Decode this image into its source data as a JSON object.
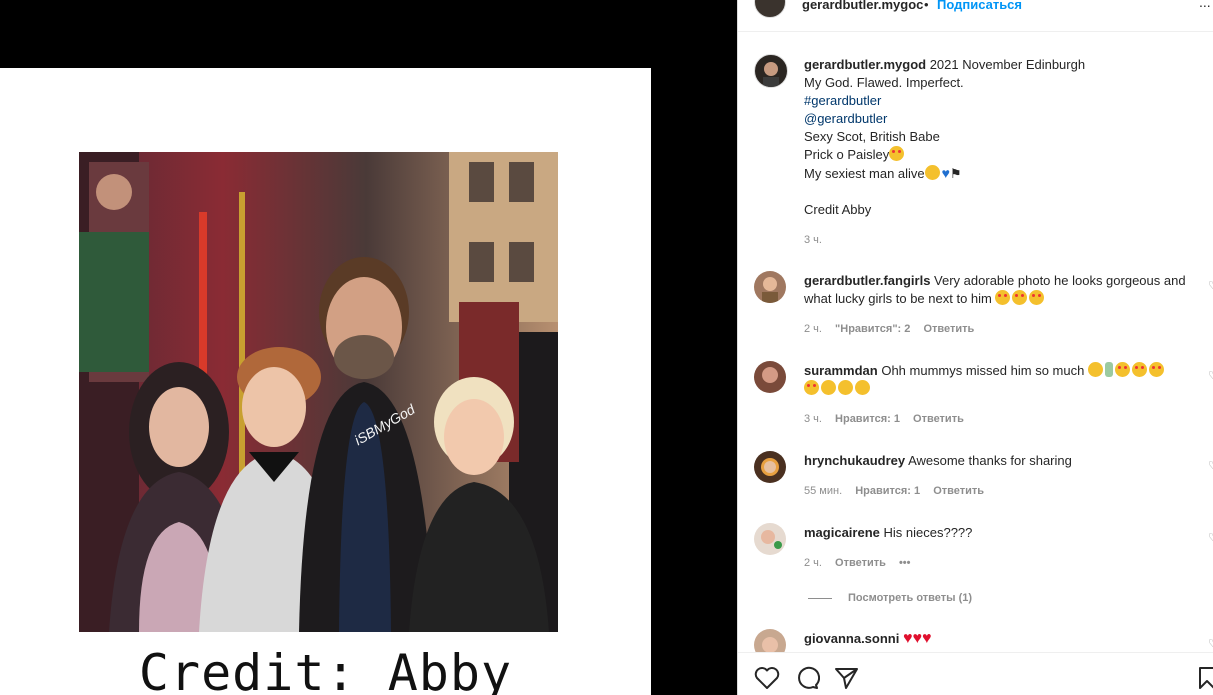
{
  "post": {
    "credit_text": "Credit: Abby",
    "watermark": "iSBMyGod"
  },
  "header": {
    "username": "gerardbutler.mygoc",
    "separator": "•",
    "follow_label": "Подписаться",
    "more_label": "..."
  },
  "caption": {
    "username": "gerardbutler.mygod",
    "lines": [
      "2021 November Edinburgh",
      "My God. Flawed. Imperfect.",
      "#gerardbutler",
      "@gerardbutler",
      "Sexy Scot, British Babe",
      "Prick o Paisley",
      "My sexiest man alive",
      "Credit Abby"
    ],
    "time": "3 ч."
  },
  "comments": [
    {
      "username": "gerardbutler.fangirls",
      "text": "Very adorable photo he looks gorgeous and what lucky girls to be next to him",
      "time": "2 ч.",
      "likes": "\"Нравится\": 2",
      "reply": "Ответить"
    },
    {
      "username": "surammdan",
      "text": "Ohh mummys missed him so much",
      "time": "3 ч.",
      "likes": "Нравится: 1",
      "reply": "Ответить"
    },
    {
      "username": "hrynchukaudrey",
      "text": "Awesome thanks for sharing",
      "time": "55 мин.",
      "likes": "Нравится: 1",
      "reply": "Ответить"
    },
    {
      "username": "magicairene",
      "text": "His nieces????",
      "time": "2 ч.",
      "reply": "Ответить",
      "more": "•••",
      "view_replies": "Посмотреть ответы (1)"
    },
    {
      "username": "giovanna.sonni",
      "text": ""
    }
  ],
  "actions": {
    "like": "heart-icon",
    "comment": "comment-icon",
    "share": "share-icon",
    "save": "bookmark-icon"
  }
}
